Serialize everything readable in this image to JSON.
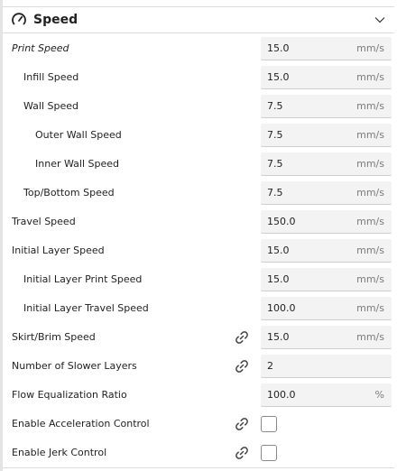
{
  "section": {
    "title": "Speed",
    "icon": "gauge-icon",
    "collapse_icon": "chevron-down-icon"
  },
  "settings": [
    {
      "label": "Print Speed",
      "value": "15.0",
      "unit": "mm/s",
      "italic": true
    },
    {
      "label": "Infill Speed",
      "value": "15.0",
      "unit": "mm/s"
    },
    {
      "label": "Wall Speed",
      "value": "7.5",
      "unit": "mm/s"
    },
    {
      "label": "Outer Wall Speed",
      "value": "7.5",
      "unit": "mm/s"
    },
    {
      "label": "Inner Wall Speed",
      "value": "7.5",
      "unit": "mm/s"
    },
    {
      "label": "Top/Bottom Speed",
      "value": "7.5",
      "unit": "mm/s"
    },
    {
      "label": "Travel Speed",
      "value": "150.0",
      "unit": "mm/s"
    },
    {
      "label": "Initial Layer Speed",
      "value": "15.0",
      "unit": "mm/s"
    },
    {
      "label": "Initial Layer Print Speed",
      "value": "15.0",
      "unit": "mm/s"
    },
    {
      "label": "Initial Layer Travel Speed",
      "value": "100.0",
      "unit": "mm/s"
    },
    {
      "label": "Skirt/Brim Speed",
      "value": "15.0",
      "unit": "mm/s",
      "linked": true
    },
    {
      "label": "Number of Slower Layers",
      "value": "2",
      "unit": "",
      "linked": true
    },
    {
      "label": "Flow Equalization Ratio",
      "value": "100.0",
      "unit": "%"
    },
    {
      "label": "Enable Acceleration Control",
      "checked": false,
      "linked": true
    },
    {
      "label": "Enable Jerk Control",
      "checked": false,
      "linked": true
    }
  ],
  "colors": {
    "field_bg": "#f3f3f3",
    "unit_text": "#7b7b7b",
    "border": "#dcdcdc"
  }
}
